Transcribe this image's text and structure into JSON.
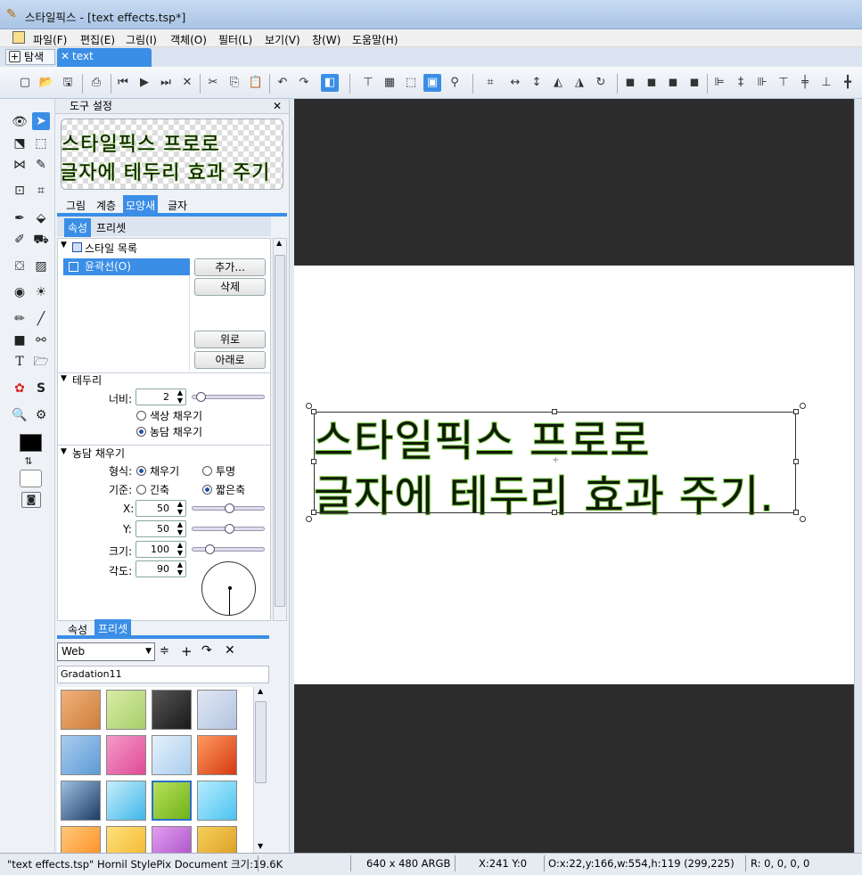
{
  "window": {
    "title": "스타일픽스 - [text effects.tsp*]"
  },
  "menu": [
    "파일(F)",
    "편집(E)",
    "그림(I)",
    "객체(O)",
    "필터(L)",
    "보기(V)",
    "창(W)",
    "도움말(H)"
  ],
  "tabs": {
    "explore": "탐색",
    "document": "text effects.tsp*"
  },
  "tool_settings": {
    "title": "도구 설정",
    "preview_line1": "스타일픽스 프로로",
    "preview_line2": "글자에 테두리 효과 주기",
    "tabs": [
      "그림",
      "계층",
      "모양새",
      "글자"
    ],
    "subtabs": [
      "속성",
      "프리셋"
    ]
  },
  "style_list": {
    "header": "스타일 목록",
    "items": [
      "윤곽선(O)"
    ],
    "buttons": {
      "add": "추가...",
      "delete": "삭제",
      "up": "위로",
      "down": "아래로"
    }
  },
  "border": {
    "header": "테두리",
    "width_label": "너비:",
    "width_value": "2",
    "width_level": 0.05,
    "color_fill": "색상 채우기",
    "gradient_fill": "농담 채우기"
  },
  "gradient": {
    "header": "농담 채우기",
    "shape_label": "형식:",
    "fill": "채우기",
    "transparent": "투명",
    "base_label": "기준:",
    "long_axis": "긴축",
    "short_axis": "짧은축",
    "x_label": "X:",
    "x_value": "50",
    "x_level": 0.5,
    "y_label": "Y:",
    "y_value": "50",
    "y_level": 0.5,
    "size_label": "크기:",
    "size_value": "100",
    "size_level": 0.2,
    "angle_label": "각도:",
    "angle_value": "90"
  },
  "presets": {
    "tabs": [
      "속성",
      "프리셋"
    ],
    "category": "Web",
    "name": "Gradation11",
    "swatches": [
      [
        "#cd7f3a",
        "#f0b07a"
      ],
      [
        "#a8cf6a",
        "#d9eba6"
      ],
      [
        "#1a1a1a",
        "#555"
      ],
      [
        "#b3c4e0",
        "#dfe7f4"
      ],
      [
        "#5e9bd6",
        "#a9ccef"
      ],
      [
        "#e04a96",
        "#f49ac8"
      ],
      [
        "#a9cdee",
        "#e6f2fc"
      ],
      [
        "#d43a10",
        "#ff9a60"
      ],
      [
        "#1d3c66",
        "#9ec0e0"
      ],
      [
        "#3fb6e8",
        "#c8eefc"
      ],
      [
        "#6fb11a",
        "#b9e05a"
      ],
      [
        "#4cc3f0",
        "#b6ecfe"
      ],
      [
        "#ff8a1c",
        "#ffc87a"
      ],
      [
        "#f1b52a",
        "#ffe07c"
      ],
      [
        "#a84cc4",
        "#e09ef0"
      ],
      [
        "#d99a1c",
        "#f6cf5c"
      ]
    ]
  },
  "canvas": {
    "line1": "스타일픽스 프로로",
    "line2": "글자에 테두리 효과 주기."
  },
  "status": {
    "file": "\"text effects.tsp\" Hornil StylePix Document 크기:19.6K",
    "dims": "640 x 480 ARGB",
    "cursor": "X:241 Y:0",
    "object": "O:x:22,y:166,w:554,h:119 (299,225)",
    "color": "R: 0, 0, 0, 0"
  }
}
